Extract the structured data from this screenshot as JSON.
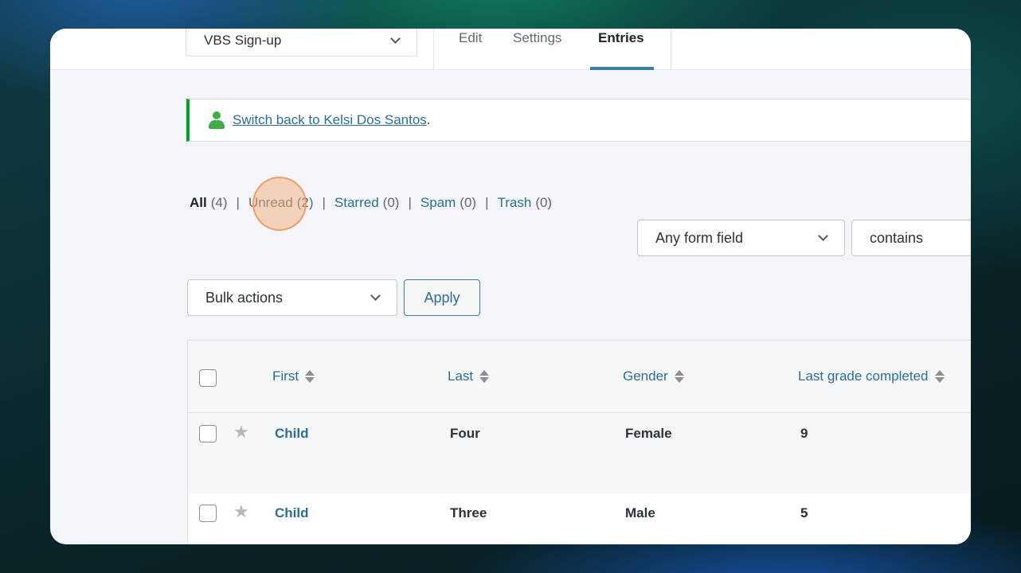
{
  "header": {
    "form_selector": "VBS Sign-up",
    "tabs": [
      {
        "label": "Edit"
      },
      {
        "label": "Settings"
      },
      {
        "label": "Entries"
      }
    ]
  },
  "notice": {
    "link_text": "Switch back to Kelsi Dos Santos",
    "suffix": "."
  },
  "filters": {
    "all_label": "All",
    "all_count": "(4)",
    "unread_label": "Unread",
    "unread_count": "(2)",
    "starred_label": "Starred",
    "starred_count": "(0)",
    "spam_label": "Spam",
    "spam_count": "(0)",
    "trash_label": "Trash",
    "trash_count": "(0)",
    "separator": "|"
  },
  "search": {
    "field_select": "Any form field",
    "operator_select": "contains"
  },
  "bulk": {
    "select": "Bulk actions",
    "apply_label": "Apply"
  },
  "table": {
    "columns": [
      "First",
      "Last",
      "Gender",
      "Last grade completed"
    ],
    "rows": [
      {
        "first": "Child",
        "last": "Four",
        "gender": "Female",
        "grade": "9"
      },
      {
        "first": "Child",
        "last": "Three",
        "gender": "Male",
        "grade": "5"
      }
    ]
  }
}
